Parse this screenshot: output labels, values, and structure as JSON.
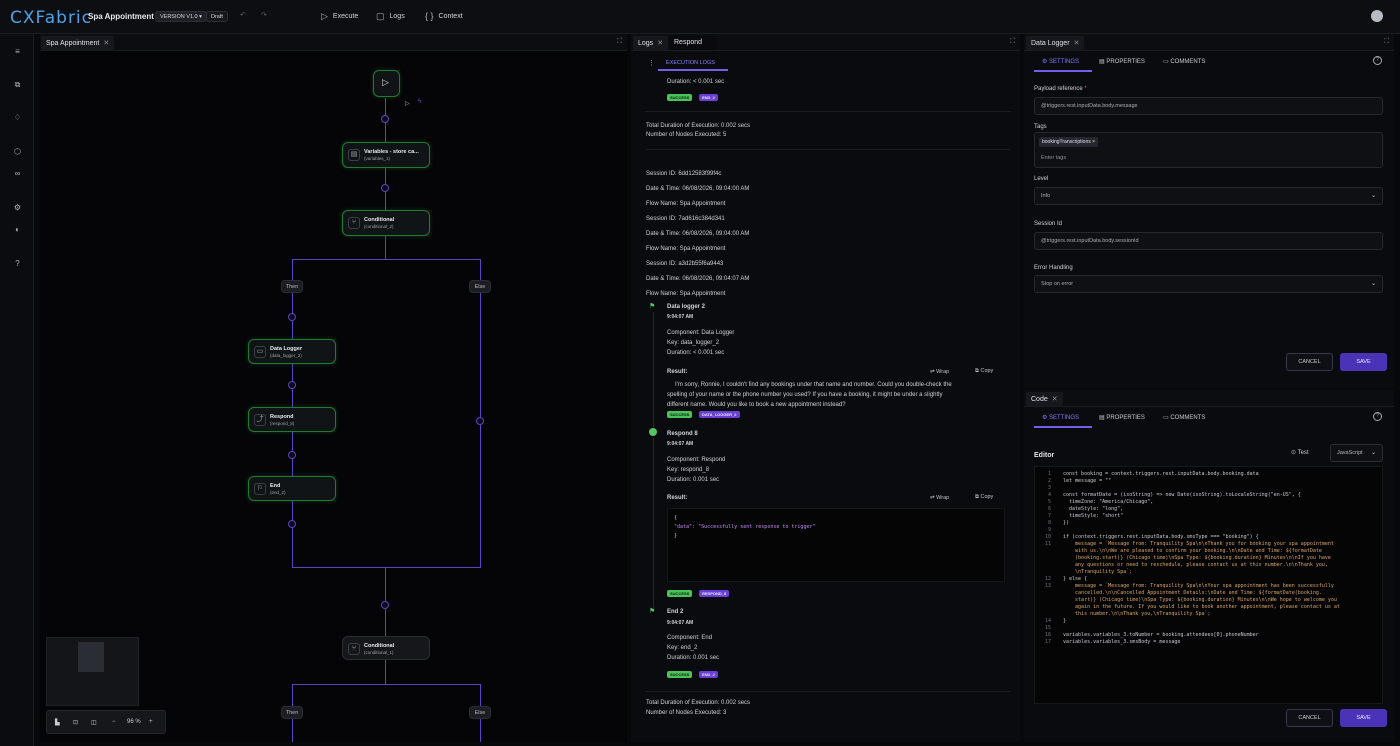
{
  "app": {
    "logo": "CXFabric",
    "flow_name": "Spa Appointment",
    "version_badge": "VERSION V1.0 ▾",
    "status_badge": "Draft"
  },
  "toolbar": {
    "undo_icon": "undo-icon",
    "redo_icon": "redo-icon",
    "execute_label": "Execute",
    "logs_label": "Logs",
    "context_label": "Context"
  },
  "sidebar": {
    "items": [
      "menu-icon",
      "copy-icon",
      "bulb-icon",
      "cube-icon",
      "binoculars-icon",
      "settings-icon",
      "toggle-icon",
      "help-icon"
    ]
  },
  "canvas": {
    "tab": "Spa Appointment",
    "nodes": [
      {
        "title": "Variables - store ca...",
        "sub": "(variables_1)"
      },
      {
        "title": "Conditional",
        "sub": "(conditional_2)"
      },
      {
        "title": "Data Logger",
        "sub": "(data_logger_2)"
      },
      {
        "title": "Respond",
        "sub": "(respond_8)"
      },
      {
        "title": "End",
        "sub": "(end_2)"
      },
      {
        "title": "Conditional",
        "sub": "(conditional_1)"
      }
    ],
    "branches": {
      "then1": "Then",
      "else1": "Else",
      "then2": "Then",
      "else2": "Else"
    },
    "zoom": "96 %"
  },
  "logs": {
    "tabs": [
      "Logs",
      "Respond"
    ],
    "section_tab": "EXECUTION LOGS",
    "top_duration": "Duration: < 0.001 sec",
    "top_badges": [
      "SUCCESS",
      "END_2"
    ],
    "summary1": [
      "Total Duration of Execution: 0.002 secs",
      "Number of Nodes Executed: 5"
    ],
    "sessions": [
      "Session ID: 6dd12583f99f4c",
      "Date & Time: 06/08/2026, 09:04:00 AM",
      "Flow Name: Spa Appointment",
      "Session ID: 7ad616c384d341",
      "Date & Time: 06/08/2026, 09:04:00 AM",
      "Flow Name: Spa Appointment",
      "Session ID: a3d2b55f6a9443",
      "Date & Time: 06/08/2026, 09:04:07 AM",
      "Flow Name: Spa Appointment"
    ],
    "step1": {
      "name": "Data logger 2",
      "time": "9:04:07 AM",
      "component": "Component: Data Logger",
      "key": "Key: data_logger_2",
      "duration": "Duration: < 0.001 sec",
      "result_label": "Result:",
      "result_lines": [
        "I'm sorry, Ronnie, I couldn't find any bookings under that name and number. Could you double-check the",
        "spelling of your name or the phone number you used? If you have a booking, it might be under a slightly",
        "different name. Would you like to book a new appointment instead?"
      ],
      "badges": [
        "SUCCESS",
        "DATA_LOGGER_2"
      ]
    },
    "step2": {
      "name": "Respond 8",
      "time": "9:04:07 AM",
      "component": "Component: Respond",
      "key": "Key: respond_8",
      "duration": "Duration: 0.001 sec",
      "result_label": "Result:",
      "code": [
        "{",
        "  \"data\": \"Successfully sent response to trigger\"",
        "}"
      ],
      "badges": [
        "SUCCESS",
        "RESPOND_8"
      ]
    },
    "step3": {
      "name": "End 2",
      "time": "9:04:07 AM",
      "component": "Component: End",
      "key": "Key: end_2",
      "duration": "Duration: 0.001 sec",
      "badges": [
        "SUCCESS",
        "END_2"
      ]
    },
    "wrap": "Wrap",
    "copy": "Copy",
    "summary2": [
      "Total Duration of Execution: 0.002 secs",
      "Number of Nodes Executed: 3"
    ]
  },
  "datalogger": {
    "tab": "Data Logger",
    "subtabs": [
      "SETTINGS",
      "PROPERTIES",
      "COMMENTS"
    ],
    "payload_label": "Payload reference",
    "payload_value": "@triggers.rest.inputData.body.message",
    "tags_label": "Tags",
    "tag_chip": "bookingTranscriptions",
    "tags_placeholder": "Enter tags",
    "level_label": "Level",
    "level_value": "Info",
    "session_label": "Session Id",
    "session_value": "@triggers.rest.inputData.body.sessionId",
    "error_label": "Error Handling",
    "error_value": "Stop on error",
    "cancel": "CANCEL",
    "save": "SAVE"
  },
  "code": {
    "tab": "Code",
    "subtabs": [
      "SETTINGS",
      "PROPERTIES",
      "COMMENTS"
    ],
    "editor_label": "Editor",
    "test": "Test",
    "language": "JavaScript",
    "lines": [
      [
        "1",
        "const booking = context.triggers.rest.inputData.body.booking.data"
      ],
      [
        "2",
        "let message = \"\""
      ],
      [
        "3",
        ""
      ],
      [
        "4",
        "const formatDate = (isoString) => new Date(isoString).toLocaleString(\"en-US\", {"
      ],
      [
        "5",
        "  timeZone: \"America/Chicago\","
      ],
      [
        "6",
        "  dateStyle: \"long\","
      ],
      [
        "7",
        "  timeStyle: \"short\""
      ],
      [
        "8",
        "})"
      ],
      [
        "9",
        ""
      ],
      [
        "10",
        "if (context.triggers.rest.inputData.body.smsType === \"booking\") {"
      ],
      [
        "11",
        "    message = `Message from: Tranquility Spa\\n\\nThank you for booking your spa appointment"
      ],
      [
        "",
        "    with us.\\n\\nWe are pleased to confirm your booking.\\n\\nDate and Time: ${formatDate"
      ],
      [
        "",
        "    (booking.start)} (Chicago time)\\nSpa Type: ${booking.duration} Minutes\\n\\nIf you have"
      ],
      [
        "",
        "    any questions or need to reschedule, please contact us at this number.\\n\\nThank you,"
      ],
      [
        "",
        "    \\nTranquility Spa`;"
      ],
      [
        "12",
        "} else {"
      ],
      [
        "13",
        "    message = `Message from: Tranquility Spa\\n\\nYour spa appointment has been successfully"
      ],
      [
        "",
        "    cancelled.\\n\\nCancelled Appointment Details:\\nDate and Time: ${formatDate(booking."
      ],
      [
        "",
        "    start)} (Chicago time)\\nSpa Type: ${booking.duration} Minutes\\n\\nWe hope to welcome you"
      ],
      [
        "",
        "    again in the future. If you would like to book another appointment, please contact us at"
      ],
      [
        "",
        "    this number.\\n\\nThank you,\\nTranquility Spa`;"
      ],
      [
        "14",
        "}"
      ],
      [
        "15",
        ""
      ],
      [
        "16",
        "variables.variables_3.toNumber = booking.attendees[0].phoneNumber"
      ],
      [
        "17",
        "variables.variables_3.smsBody = message"
      ]
    ],
    "cancel": "CANCEL",
    "save": "SAVE"
  },
  "colors": {
    "accent": "#7360e8",
    "edge": "#5b45c4",
    "node_border": "#1f7a32",
    "success": "#4cc25a",
    "badge_purple": "#6a3fd6"
  }
}
